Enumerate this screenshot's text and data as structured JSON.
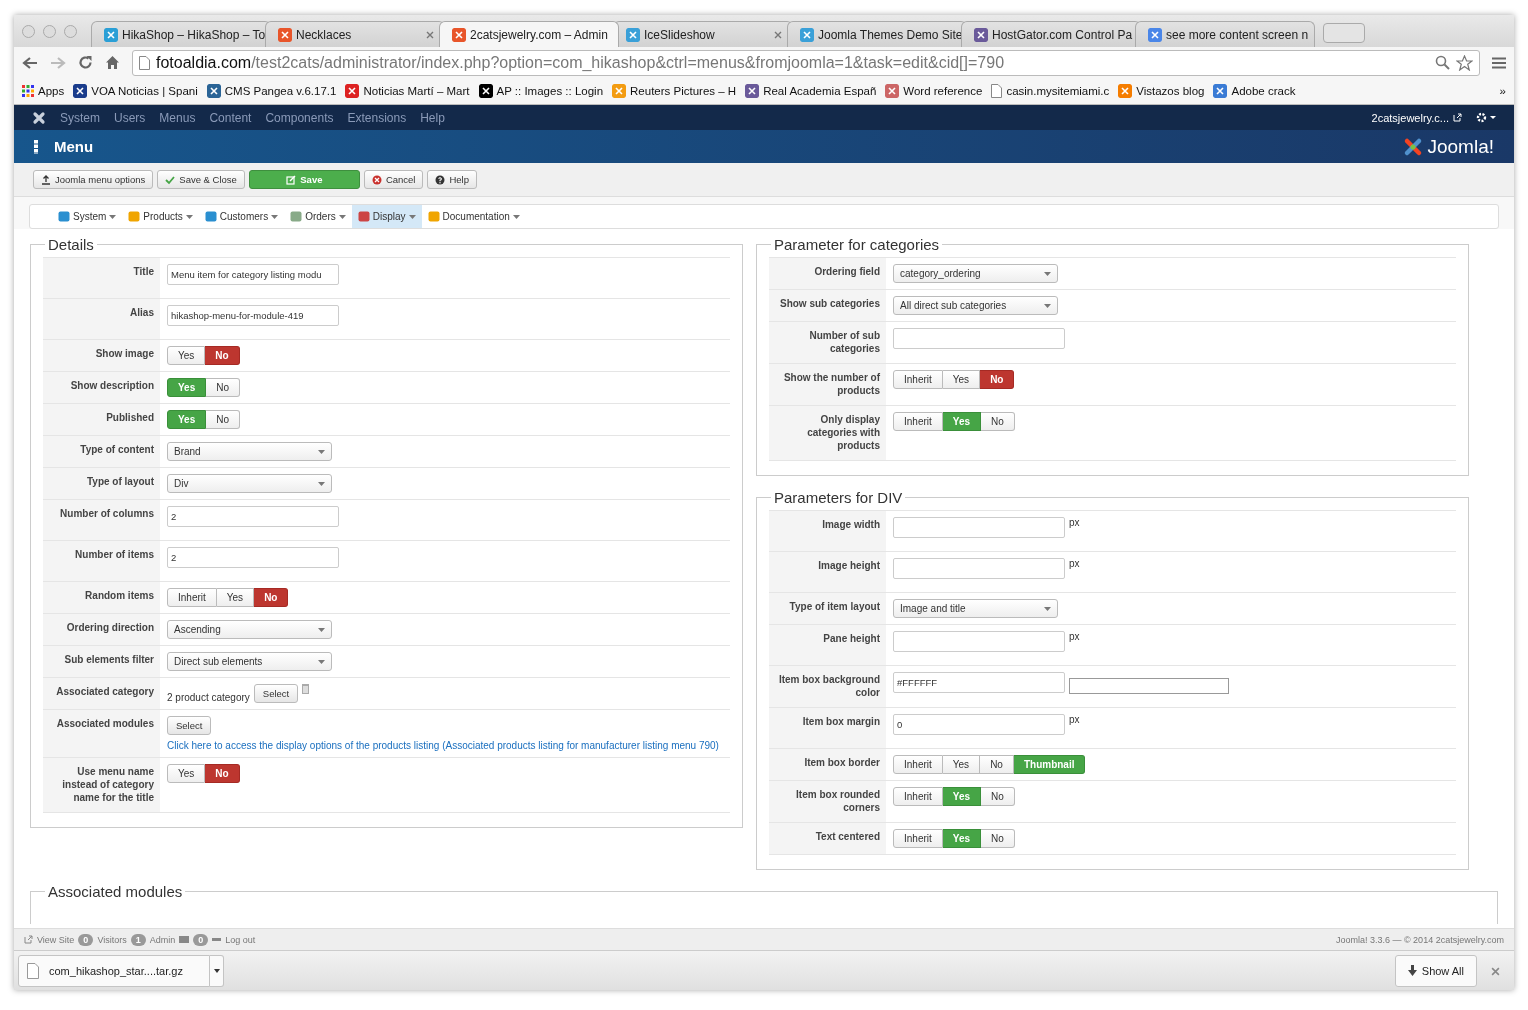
{
  "browser": {
    "tabs": [
      {
        "title": "HikaShop – HikaShop – To",
        "selected": false
      },
      {
        "title": "Necklaces",
        "selected": false
      },
      {
        "title": "2catsjewelry.com – Admin",
        "selected": true
      },
      {
        "title": "IceSlideshow",
        "selected": false
      },
      {
        "title": "Joomla Themes Demo Site",
        "selected": false
      },
      {
        "title": "HostGator.com Control Pa",
        "selected": false
      },
      {
        "title": "see more content screen n",
        "selected": false
      }
    ],
    "url": {
      "host": "fotoaldia.com",
      "path": "/test2cats/administrator/index.php?option=com_hikashop&ctrl=menus&fromjoomla=1&task=edit&cid[]=790"
    },
    "bookmarks": [
      "Apps",
      "VOA Noticias | Spani",
      "CMS Pangea v.6.17.1",
      "Noticias Martí – Mart",
      "AP :: Images :: Login",
      "Reuters Pictures – H",
      "Real Academia Españ",
      "Word reference",
      "casin.mysitemiami.c",
      "Vistazos blog",
      "Adobe crack"
    ],
    "bookmarks_more": "»"
  },
  "admin_menu": {
    "items": [
      "System",
      "Users",
      "Menus",
      "Content",
      "Components",
      "Extensions",
      "Help"
    ],
    "user": "2catsjewelry.c..."
  },
  "header": {
    "title": "Menu",
    "brand": "Joomla!"
  },
  "toolbar": [
    {
      "label": "Joomla menu options",
      "kind": "default"
    },
    {
      "label": "Save & Close",
      "kind": "default"
    },
    {
      "label": "Save",
      "kind": "primary"
    },
    {
      "label": "Cancel",
      "kind": "default"
    },
    {
      "label": "Help",
      "kind": "default"
    }
  ],
  "submenu": [
    {
      "label": "System",
      "selected": false
    },
    {
      "label": "Products",
      "selected": false
    },
    {
      "label": "Customers",
      "selected": false
    },
    {
      "label": "Orders",
      "selected": false
    },
    {
      "label": "Display",
      "selected": true
    },
    {
      "label": "Documentation",
      "selected": false
    }
  ],
  "details": {
    "title": "Details",
    "rows": [
      {
        "kind": "input",
        "label": "Title",
        "value": "Menu item for category listing modu"
      },
      {
        "kind": "input",
        "label": "Alias",
        "value": "hikashop-menu-for-module-419"
      },
      {
        "kind": "toggle",
        "label": "Show image",
        "negative": true,
        "options": [
          {
            "label": "Yes",
            "selected": false
          },
          {
            "label": "No",
            "selected": true
          }
        ]
      },
      {
        "kind": "toggle",
        "label": "Show description",
        "negative": false,
        "options": [
          {
            "label": "Yes",
            "selected": true
          },
          {
            "label": "No",
            "selected": false
          }
        ]
      },
      {
        "kind": "toggle",
        "label": "Published",
        "negative": false,
        "options": [
          {
            "label": "Yes",
            "selected": true
          },
          {
            "label": "No",
            "selected": false
          }
        ]
      },
      {
        "kind": "select",
        "label": "Type of content",
        "value": "Brand"
      },
      {
        "kind": "select",
        "label": "Type of layout",
        "value": "Div"
      },
      {
        "kind": "input",
        "label": "Number of columns",
        "value": "2"
      },
      {
        "kind": "input",
        "label": "Number of items",
        "value": "2"
      },
      {
        "kind": "toggle",
        "label": "Random items",
        "negative": true,
        "options": [
          {
            "label": "Inherit",
            "selected": false
          },
          {
            "label": "Yes",
            "selected": false
          },
          {
            "label": "No",
            "selected": true
          }
        ]
      },
      {
        "kind": "select",
        "label": "Ordering direction",
        "value": "Ascending"
      },
      {
        "kind": "select",
        "label": "Sub elements filter",
        "value": "Direct sub elements"
      },
      {
        "kind": "category",
        "label": "Associated category",
        "value": "2 product category",
        "button": "Select"
      },
      {
        "kind": "modules",
        "label": "Associated modules",
        "button": "Select",
        "link": "Click here to access the display options of the products listing (Associated products listing for manufacturer listing menu 790)"
      },
      {
        "kind": "toggle",
        "label": "Use menu name instead of category name for the title",
        "negative": true,
        "options": [
          {
            "label": "Yes",
            "selected": false
          },
          {
            "label": "No",
            "selected": true
          }
        ]
      }
    ]
  },
  "categories": {
    "title": "Parameter for categories",
    "rows": [
      {
        "kind": "select",
        "label": "Ordering field",
        "value": "category_ordering"
      },
      {
        "kind": "select",
        "label": "Show sub categories",
        "value": "All direct sub categories"
      },
      {
        "kind": "input",
        "label": "Number of sub categories"
      },
      {
        "kind": "toggle",
        "label": "Show the number of products",
        "negative": true,
        "options": [
          {
            "label": "Inherit",
            "selected": false
          },
          {
            "label": "Yes",
            "selected": false
          },
          {
            "label": "No",
            "selected": true
          }
        ]
      },
      {
        "kind": "toggle",
        "label": "Only display categories with products",
        "negative": false,
        "options": [
          {
            "label": "Inherit",
            "selected": false
          },
          {
            "label": "Yes",
            "selected": true
          },
          {
            "label": "No",
            "selected": false
          }
        ]
      }
    ]
  },
  "div_params": {
    "title": "Parameters for DIV",
    "rows": [
      {
        "kind": "input",
        "label": "Image width",
        "suffix": "px"
      },
      {
        "kind": "input",
        "label": "Image height",
        "suffix": "px"
      },
      {
        "kind": "select",
        "label": "Type of item layout",
        "value": "Image and title"
      },
      {
        "kind": "input",
        "label": "Pane height",
        "suffix": "px"
      },
      {
        "kind": "color",
        "label": "Item box background color",
        "value": "#FFFFFF"
      },
      {
        "kind": "input",
        "label": "Item box margin",
        "value": "0",
        "suffix": "px"
      },
      {
        "kind": "toggle",
        "label": "Item box border",
        "negative": false,
        "options": [
          {
            "label": "Inherit",
            "selected": false
          },
          {
            "label": "Yes",
            "selected": false
          },
          {
            "label": "No",
            "selected": false
          },
          {
            "label": "Thumbnail",
            "selected": true
          }
        ]
      },
      {
        "kind": "toggle",
        "label": "Item box rounded corners",
        "negative": false,
        "options": [
          {
            "label": "Inherit",
            "selected": false
          },
          {
            "label": "Yes",
            "selected": true
          },
          {
            "label": "No",
            "selected": false
          }
        ]
      },
      {
        "kind": "toggle",
        "label": "Text centered",
        "negative": false,
        "options": [
          {
            "label": "Inherit",
            "selected": false
          },
          {
            "label": "Yes",
            "selected": true
          },
          {
            "label": "No",
            "selected": false
          }
        ]
      }
    ]
  },
  "associated_modules": {
    "title": "Associated modules"
  },
  "status_bar": {
    "view_site": "View Site",
    "visitors_count": "0",
    "visitors": "Visitors",
    "admin_count": "1",
    "admin": "Admin",
    "messages_count": "0",
    "logout": "Log out",
    "version": "Joomla! 3.3.6  —  © 2014 2catsjewelry.com"
  },
  "downloads": {
    "file": "com_hikashop_star....tar.gz",
    "show_all": "Show All"
  }
}
